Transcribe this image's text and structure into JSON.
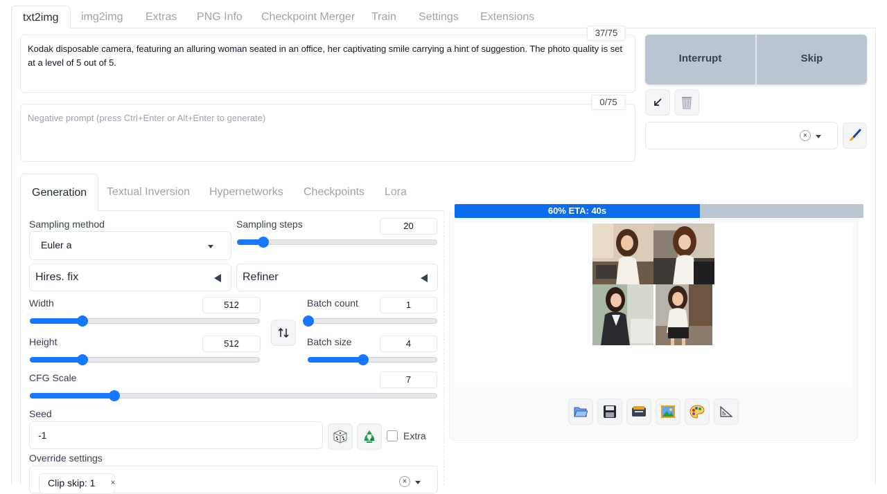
{
  "top_tabs": [
    {
      "label": "txt2img",
      "active": true
    },
    {
      "label": "img2img"
    },
    {
      "label": "Extras"
    },
    {
      "label": "PNG Info"
    },
    {
      "label": "Checkpoint Merger"
    },
    {
      "label": "Train"
    },
    {
      "label": "Settings"
    },
    {
      "label": "Extensions"
    }
  ],
  "prompt": {
    "text": "Kodak disposable camera, featuring an alluring woman seated in an office, her captivating smile carrying a hint of suggestion. The photo quality is set at a level of 5 out of 5.",
    "token_count": "37/75"
  },
  "negative_prompt": {
    "placeholder": "Negative prompt (press Ctrl+Enter or Alt+Enter to generate)",
    "token_count": "0/75"
  },
  "actions": {
    "interrupt_label": "Interrupt",
    "skip_label": "Skip"
  },
  "tools": {
    "read_params_icon": "arrow-down-left-icon",
    "clear_icon": "trash-icon",
    "edit_styles_icon": "paintbrush-icon"
  },
  "styles_dropdown": {
    "value": "",
    "clear_symbol": "×"
  },
  "sub_tabs": [
    {
      "label": "Generation",
      "active": true
    },
    {
      "label": "Textual Inversion"
    },
    {
      "label": "Hypernetworks"
    },
    {
      "label": "Checkpoints"
    },
    {
      "label": "Lora"
    }
  ],
  "generation": {
    "sampling_method": {
      "label": "Sampling method",
      "value": "Euler a"
    },
    "sampling_steps": {
      "label": "Sampling steps",
      "value": "20",
      "min": 1,
      "max": 150,
      "current": 20
    },
    "hires_fix": {
      "label": "Hires. fix"
    },
    "refiner": {
      "label": "Refiner"
    },
    "width": {
      "label": "Width",
      "value": "512",
      "min": 64,
      "max": 2048,
      "current": 512
    },
    "height": {
      "label": "Height",
      "value": "512",
      "min": 64,
      "max": 2048,
      "current": 512
    },
    "batch_count": {
      "label": "Batch count",
      "value": "1",
      "min": 1,
      "max": 100,
      "current": 1
    },
    "batch_size": {
      "label": "Batch size",
      "value": "4",
      "min": 1,
      "max": 8,
      "current": 4
    },
    "cfg_scale": {
      "label": "CFG Scale",
      "value": "7",
      "min": 1,
      "max": 30,
      "current": 7
    },
    "seed": {
      "label": "Seed",
      "value": "-1",
      "extra_label": "Extra"
    },
    "override_settings": {
      "label": "Override settings",
      "chip": "Clip skip: 1",
      "clear_symbol": "×"
    }
  },
  "output": {
    "progress_fraction": 0.6,
    "progress_text": "60% ETA: 40s",
    "buttons": [
      "folder-icon",
      "save-icon",
      "zip-icon",
      "image-icon",
      "palette-icon",
      "ruler-icon"
    ]
  },
  "colors": {
    "accent": "#1677ff",
    "progress_fill": "#0b6cf0",
    "progress_track": "#b9c6d1",
    "action_button": "#b9c6d1"
  }
}
